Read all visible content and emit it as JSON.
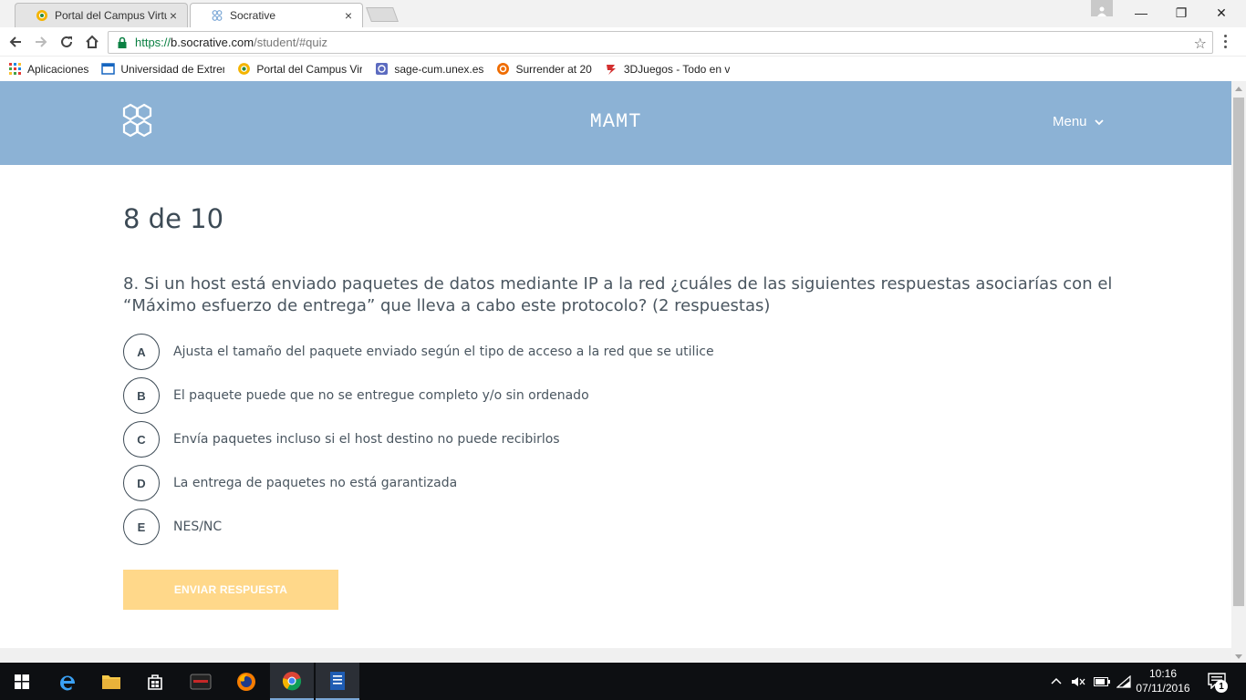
{
  "browser": {
    "tabs": [
      {
        "title": "Portal del Campus Virtua",
        "active": false,
        "favicon": "campus-portal-icon"
      },
      {
        "title": "Socrative",
        "active": true,
        "favicon": "socrative-icon"
      }
    ],
    "close_glyph": "×",
    "window_controls": {
      "minimize": "—",
      "restore": "❐",
      "close": "✕"
    },
    "url": {
      "scheme": "https://",
      "host": "b.socrative.com",
      "path": "/student/#quiz"
    },
    "bookmarks": [
      {
        "label": "Aplicaciones",
        "icon": "apps-grid-icon"
      },
      {
        "label": "Universidad de Extrem",
        "icon": "university-icon"
      },
      {
        "label": "Portal del Campus Vir",
        "icon": "campus-portal-icon"
      },
      {
        "label": "sage-cum.unex.es",
        "icon": "sage-icon"
      },
      {
        "label": "Surrender at 20",
        "icon": "surrender-icon"
      },
      {
        "label": "3DJuegos - Todo en v",
        "icon": "3djuegos-icon"
      }
    ]
  },
  "page": {
    "room_name": "MAMT",
    "menu_label": "Menu",
    "progress": "8 de 10",
    "question": "8. Si un host está enviado paquetes de datos mediante IP a la red ¿cuáles de las siguientes respuestas asociarías con el “Máximo esfuerzo de entrega” que lleva a cabo este protocolo? (2 respuestas)",
    "answers": [
      {
        "letter": "A",
        "text": "Ajusta el tamaño del paquete enviado según el tipo de acceso a la red que se utilice"
      },
      {
        "letter": "B",
        "text": "El paquete puede que no se entregue completo y/o sin ordenado"
      },
      {
        "letter": "C",
        "text": "Envía paquetes incluso si el host destino no puede recibirlos"
      },
      {
        "letter": "D",
        "text": "La entrega de paquetes no está garantizada"
      },
      {
        "letter": "E",
        "text": "NES/NC"
      }
    ],
    "submit_label": "ENVIAR RESPUESTA",
    "colors": {
      "header": "#8cb2d5",
      "submit_disabled": "#ffd88a",
      "text": "#3c4a55"
    }
  },
  "taskbar": {
    "time": "10:16",
    "date": "07/11/2016",
    "notification_count": "1"
  }
}
